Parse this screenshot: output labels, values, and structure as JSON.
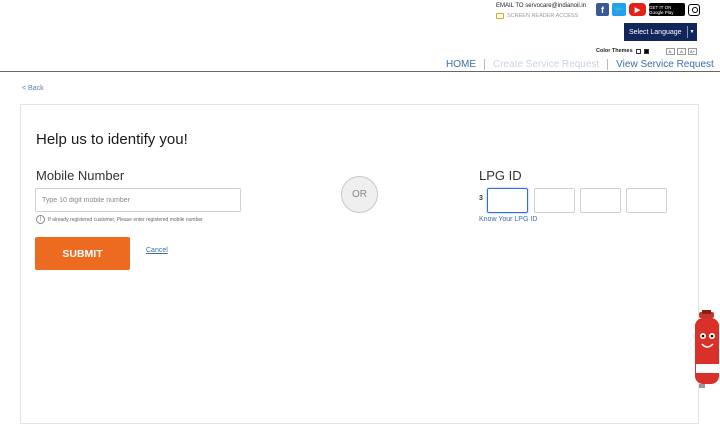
{
  "header": {
    "email_text": "EMAIL TO servocare@indianoil.in",
    "screen_reader": "SCREEN READER ACCESS",
    "social": [
      "facebook-icon",
      "twitter-icon",
      "youtube-icon",
      "google-play-icon",
      "instagram-icon"
    ],
    "google_play_label": "GET IT ON Google Play",
    "select_language": "Select Language",
    "color_themes_label": "Color Themes",
    "font_sizes": [
      "A-",
      "A",
      "A+"
    ]
  },
  "nav": {
    "home": "HOME",
    "create": "Create Service Request",
    "view": "View Service Request"
  },
  "back_label": "< Back",
  "form": {
    "title": "Help us to identify you!",
    "mobile_label": "Mobile Number",
    "mobile_placeholder": "Type 10 digit mobile number",
    "mobile_hint": "If already registered customer, Please enter registered mobile number",
    "submit_label": "SUBMIT",
    "cancel_label": "Cancel",
    "or_label": "OR",
    "lpg_label": "LPG ID",
    "lpg_prefix": "3",
    "lpg_boxes": [
      "",
      "",
      "",
      ""
    ],
    "know_lpg": "Know Your LPG ID"
  },
  "colors": {
    "accent": "#ec6b21",
    "nav_blue": "#13265c",
    "link": "#3a6fa8"
  }
}
